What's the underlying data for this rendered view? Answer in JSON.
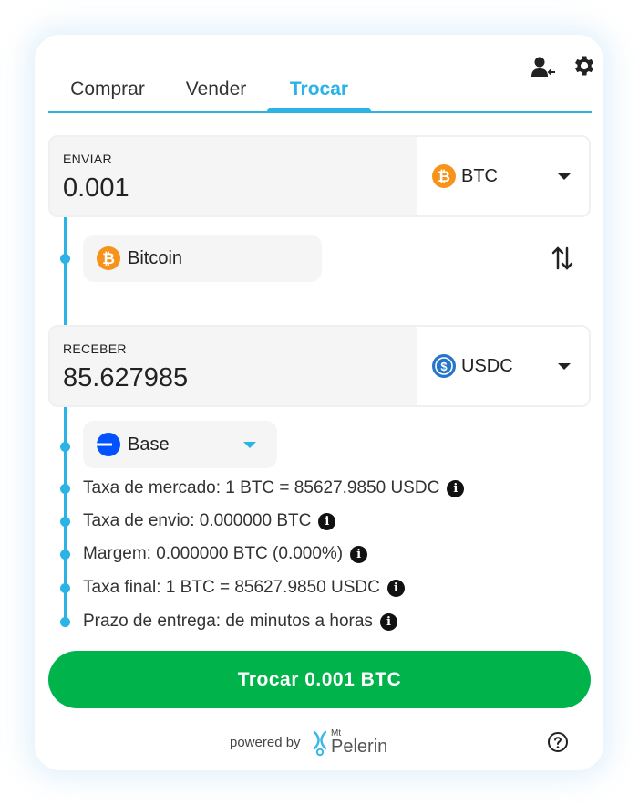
{
  "tabs": [
    {
      "label": "Comprar"
    },
    {
      "label": "Vender"
    },
    {
      "label": "Trocar"
    }
  ],
  "active_tab": "Trocar",
  "send": {
    "label": "ENVIAR",
    "amount": "0.001",
    "currency": "BTC",
    "currency_icon": "bitcoin-icon"
  },
  "send_network": {
    "label": "Bitcoin",
    "icon": "bitcoin-icon"
  },
  "receive": {
    "label": "RECEBER",
    "amount": "85.627985",
    "currency": "USDC",
    "currency_icon": "usdc-icon"
  },
  "receive_network": {
    "label": "Base",
    "icon": "base-network-icon"
  },
  "info": [
    {
      "text": "Taxa de mercado: 1 BTC = 85627.9850 USDC"
    },
    {
      "text": "Taxa de envio: 0.000000 BTC"
    },
    {
      "text": "Margem: 0.000000 BTC (0.000%)"
    },
    {
      "text": "Taxa final: 1 BTC = 85627.9850 USDC"
    },
    {
      "text": "Prazo de entrega: de minutos a horas"
    }
  ],
  "cta_label": "Trocar 0.001 BTC",
  "footer": {
    "powered_by": "powered by",
    "brand_top": "Mt",
    "brand_name": "Pelerin"
  },
  "colors": {
    "accent": "#2bb3e6",
    "cta": "#00b34a",
    "bitcoin": "#f7931a",
    "usdc": "#2775ca",
    "base": "#0052ff"
  }
}
